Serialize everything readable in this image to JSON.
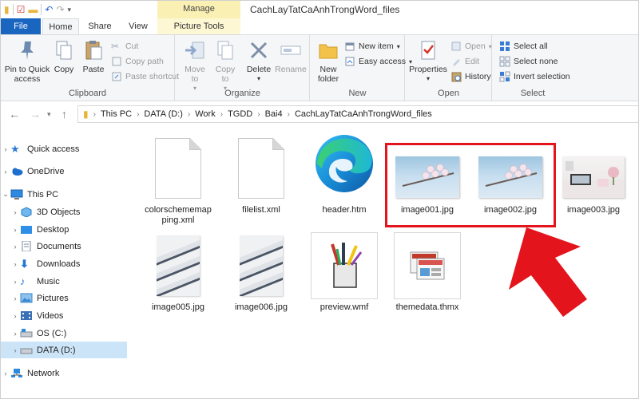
{
  "window": {
    "title": "CachLayTatCaAnhTrongWord_files",
    "contextual_tab": "Manage"
  },
  "tabs": [
    {
      "label": "File"
    },
    {
      "label": "Home"
    },
    {
      "label": "Share"
    },
    {
      "label": "View"
    },
    {
      "label": "Picture Tools"
    }
  ],
  "ribbon": {
    "clipboard": {
      "label": "Clipboard",
      "pin": "Pin to Quick access",
      "copy": "Copy",
      "paste": "Paste",
      "cut": "Cut",
      "copy_path": "Copy path",
      "paste_shortcut": "Paste shortcut"
    },
    "organize": {
      "label": "Organize",
      "move_to": "Move to",
      "copy_to": "Copy to",
      "delete": "Delete",
      "rename": "Rename"
    },
    "new": {
      "label": "New",
      "new_folder": "New folder",
      "new_item": "New item",
      "easy_access": "Easy access"
    },
    "open": {
      "label": "Open",
      "properties": "Properties",
      "open": "Open",
      "edit": "Edit",
      "history": "History"
    },
    "select": {
      "label": "Select",
      "select_all": "Select all",
      "select_none": "Select none",
      "invert": "Invert selection"
    }
  },
  "address": {
    "crumbs": [
      "This PC",
      "DATA (D:)",
      "Work",
      "TGDD",
      "Bai4",
      "CachLayTatCaAnhTrongWord_files"
    ]
  },
  "nav": {
    "items": [
      {
        "label": "Quick access",
        "icon": "star-icon"
      },
      {
        "label": "OneDrive",
        "icon": "cloud-icon"
      },
      {
        "label": "This PC",
        "icon": "computer-icon"
      },
      {
        "label": "3D Objects",
        "icon": "cube-icon"
      },
      {
        "label": "Desktop",
        "icon": "desktop-icon"
      },
      {
        "label": "Documents",
        "icon": "documents-icon"
      },
      {
        "label": "Downloads",
        "icon": "download-icon"
      },
      {
        "label": "Music",
        "icon": "music-icon"
      },
      {
        "label": "Pictures",
        "icon": "pictures-icon"
      },
      {
        "label": "Videos",
        "icon": "videos-icon"
      },
      {
        "label": "OS (C:)",
        "icon": "drive-icon"
      },
      {
        "label": "DATA (D:)",
        "icon": "drive-icon"
      },
      {
        "label": "Network",
        "icon": "network-icon"
      }
    ],
    "selected": "DATA (D:)"
  },
  "files": [
    {
      "name_line1": "colorschememap",
      "name_line2": "ping.xml",
      "type": "document"
    },
    {
      "name_line1": "filelist.xml",
      "name_line2": "",
      "type": "document"
    },
    {
      "name_line1": "header.htm",
      "name_line2": "",
      "type": "edge"
    },
    {
      "name_line1": "image001.jpg",
      "name_line2": "",
      "type": "photo-blossom"
    },
    {
      "name_line1": "image002.jpg",
      "name_line2": "",
      "type": "photo-blossom"
    },
    {
      "name_line1": "image003.jpg",
      "name_line2": "",
      "type": "photo-desk"
    },
    {
      "name_line1": "image005.jpg",
      "name_line2": "",
      "type": "photo-building"
    },
    {
      "name_line1": "image006.jpg",
      "name_line2": "",
      "type": "photo-building"
    },
    {
      "name_line1": "preview.wmf",
      "name_line2": "",
      "type": "wmf"
    },
    {
      "name_line1": "themedata.thmx",
      "name_line2": "",
      "type": "thmx"
    }
  ],
  "colors": {
    "accent": "#1a65c0",
    "manage_tab": "#faf0b4",
    "selection": "#cce4f7",
    "highlight": "#e3141b"
  }
}
